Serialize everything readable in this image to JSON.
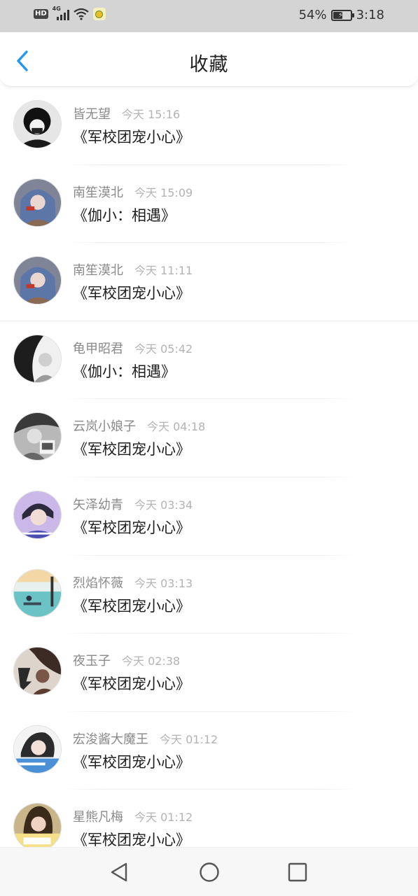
{
  "status_bar": {
    "network_badge": "HD",
    "network_type": "4G",
    "battery_percent": "54%",
    "battery_level": 0.54,
    "time": "3:18"
  },
  "header": {
    "title": "收藏",
    "accent_color": "#2196f3"
  },
  "items": [
    {
      "name": "皆无望",
      "time": "今天 15:16",
      "title": "《军校团宠小心》"
    },
    {
      "name": "南笙漠北",
      "time": "今天 15:09",
      "title": "《伽小：相遇》"
    },
    {
      "name": "南笙漠北",
      "time": "今天 11:11",
      "title": "《军校团宠小心》"
    },
    {
      "name": "龟甲昭君",
      "time": "今天 05:42",
      "title": "《伽小：相遇》"
    },
    {
      "name": "云岚小娘子",
      "time": "今天 04:18",
      "title": "《军校团宠小心》"
    },
    {
      "name": "矢泽幼青",
      "time": "今天 03:34",
      "title": "《军校团宠小心》"
    },
    {
      "name": "烈焰怀薇",
      "time": "今天 03:13",
      "title": "《军校团宠小心》"
    },
    {
      "name": "夜玉子",
      "time": "今天 02:38",
      "title": "《军校团宠小心》"
    },
    {
      "name": "宏浚酱大魔王",
      "time": "今天 01:12",
      "title": "《军校团宠小心》"
    },
    {
      "name": "星熊凡梅",
      "time": "今天 01:12",
      "title": "《军校团宠小心》"
    }
  ],
  "nav": {
    "back_icon": "triangle-back-icon",
    "home_icon": "circle-home-icon",
    "recent_icon": "square-recent-icon"
  }
}
